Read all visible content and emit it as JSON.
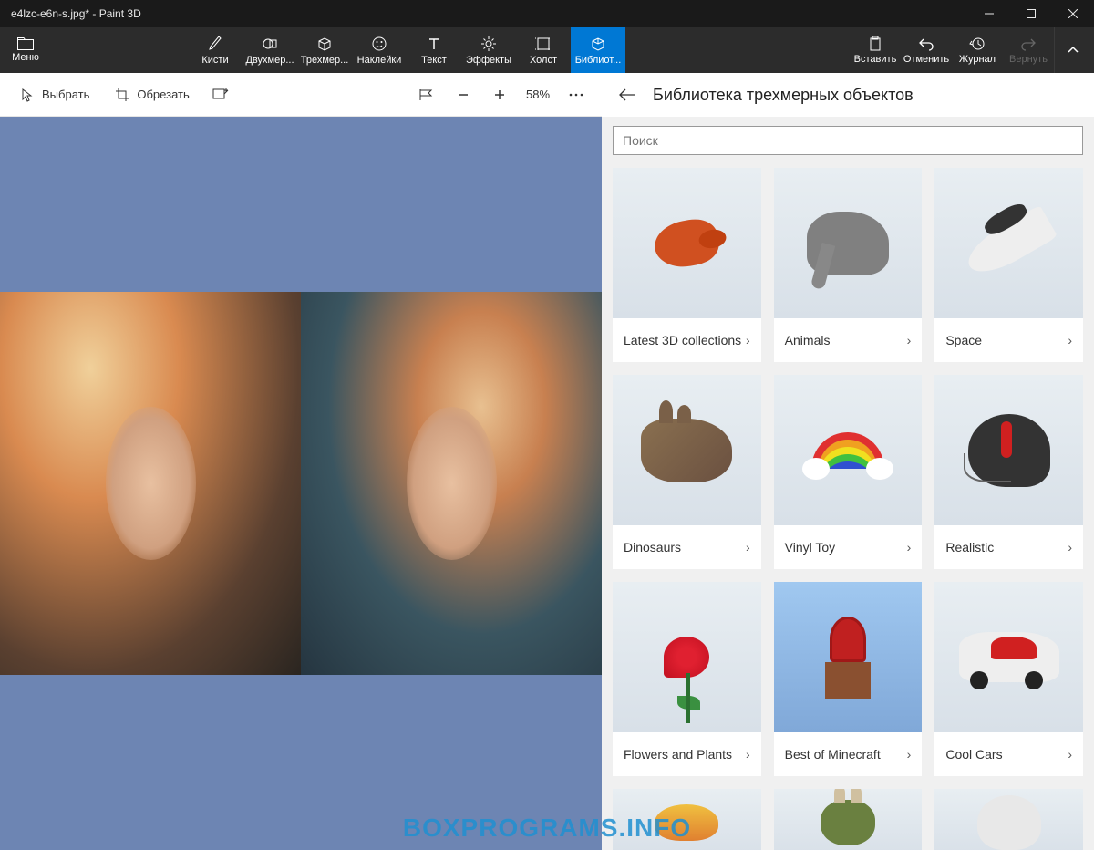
{
  "titlebar": {
    "title": "e4lzc-e6n-s.jpg* - Paint 3D"
  },
  "menu": {
    "label": "Меню"
  },
  "tools": {
    "brushes": "Кисти",
    "two_d": "Двухмер...",
    "three_d": "Трехмер...",
    "stickers": "Наклейки",
    "text": "Текст",
    "effects": "Эффекты",
    "canvas": "Холст",
    "library": "Библиот..."
  },
  "right_tools": {
    "paste": "Вставить",
    "undo": "Отменить",
    "history": "Журнал",
    "redo": "Вернуть"
  },
  "subbar": {
    "select": "Выбрать",
    "crop": "Обрезать",
    "zoom": "58%"
  },
  "panel": {
    "title": "Библиотека трехмерных объектов",
    "search_placeholder": "Поиск"
  },
  "categories": [
    {
      "label": "Latest 3D collections"
    },
    {
      "label": "Animals"
    },
    {
      "label": "Space"
    },
    {
      "label": "Dinosaurs"
    },
    {
      "label": "Vinyl Toy"
    },
    {
      "label": "Realistic"
    },
    {
      "label": "Flowers and Plants"
    },
    {
      "label": "Best of Minecraft"
    },
    {
      "label": "Cool Cars"
    }
  ],
  "watermark": "BOXPROGRAMS.INFO"
}
